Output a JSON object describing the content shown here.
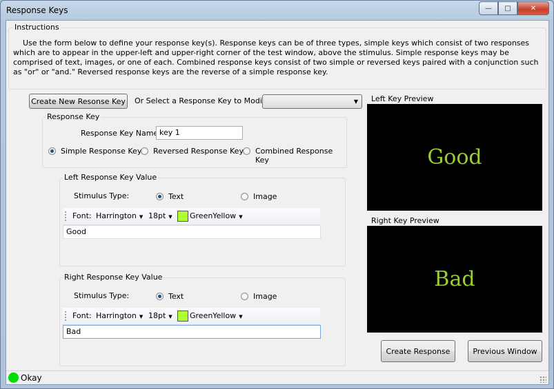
{
  "window": {
    "title": "Response Keys"
  },
  "instructions": {
    "label": "Instructions",
    "text": "Use the form below to define your response key(s).  Response keys can be of three types, simple keys which consist of two responses which are to appear in the upper-left and upper-right corner of the test window, above the stimulus.  Simple response keys may be comprised of text, images, or one of each.  Combined response keys consist of two simple or reversed keys paired with a conjunction such as \"or\" or \"and.\"  Reversed response keys are the reverse of a simple response key."
  },
  "top": {
    "create_button": "Create New Resonse Key",
    "select_label": "Or Select a Response Key to Modify:",
    "select_value": ""
  },
  "response_key": {
    "label": "Response Key",
    "name_label": "Response Key Name:",
    "name_value": "key 1",
    "types": [
      {
        "label": "Simple Response Key",
        "selected": true
      },
      {
        "label": "Reversed Response Key",
        "selected": false
      },
      {
        "label": "Combined Response Key",
        "selected": false
      }
    ]
  },
  "left_value": {
    "label": "Left Response Key Value",
    "stim_label": "Stimulus Type:",
    "text_option": "Text",
    "image_option": "Image",
    "font_label": "Font:",
    "font": "Harrington",
    "size": "18pt",
    "color_name": "GreenYellow",
    "color": "#adff2f",
    "text": "Good"
  },
  "right_value": {
    "label": "Right Response Key Value",
    "stim_label": "Stimulus Type:",
    "text_option": "Text",
    "image_option": "Image",
    "font_label": "Font:",
    "font": "Harrington",
    "size": "18pt",
    "color_name": "GreenYellow",
    "color": "#adff2f",
    "text": "Bad"
  },
  "previews": {
    "left_label": "Left Key Preview",
    "left_text": "Good",
    "right_label": "Right Key Preview",
    "right_text": "Bad",
    "text_color": "#9acd32"
  },
  "buttons": {
    "create": "Create Response",
    "previous": "Previous Window"
  },
  "status": {
    "text": "Okay",
    "color": "#00e000"
  }
}
